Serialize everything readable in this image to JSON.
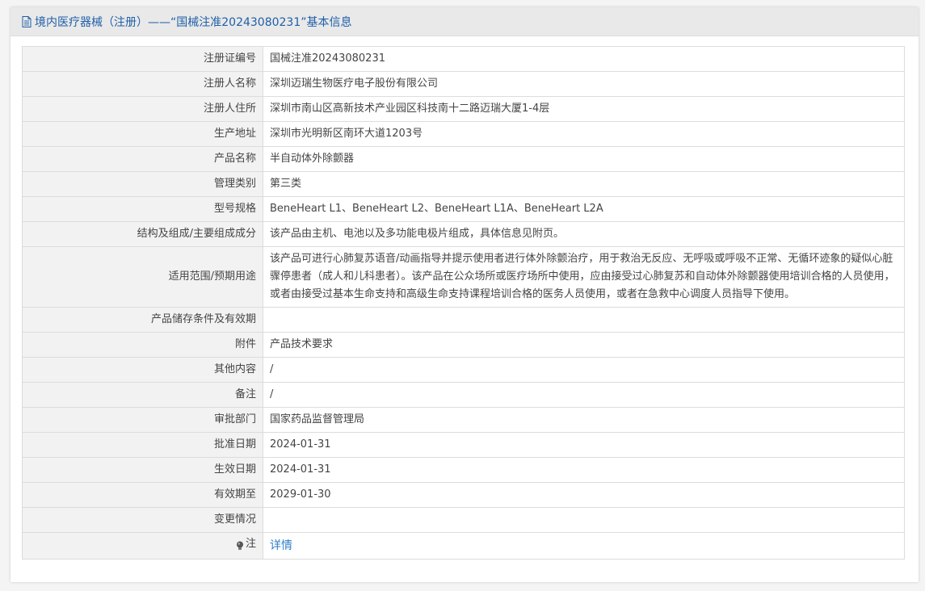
{
  "header": {
    "title": "境内医疗器械（注册）——“国械注准20243080231”基本信息"
  },
  "rows": [
    {
      "label": "注册证编号",
      "value": "国械注准20243080231"
    },
    {
      "label": "注册人名称",
      "value": "深圳迈瑞生物医疗电子股份有限公司"
    },
    {
      "label": "注册人住所",
      "value": "深圳市南山区高新技术产业园区科技南十二路迈瑞大厦1-4层"
    },
    {
      "label": "生产地址",
      "value": "深圳市光明新区南环大道1203号"
    },
    {
      "label": "产品名称",
      "value": "半自动体外除颤器"
    },
    {
      "label": "管理类别",
      "value": "第三类"
    },
    {
      "label": "型号规格",
      "value": "BeneHeart L1、BeneHeart L2、BeneHeart L1A、BeneHeart L2A"
    },
    {
      "label": "结构及组成/主要组成成分",
      "value": "该产品由主机、电池以及多功能电极片组成，具体信息见附页。"
    },
    {
      "label": "适用范围/预期用途",
      "value": "该产品可进行心肺复苏语音/动画指导并提示使用者进行体外除颤治疗，用于救治无反应、无呼吸或呼吸不正常、无循环迹象的疑似心脏骤停患者（成人和儿科患者）。该产品在公众场所或医疗场所中使用，应由接受过心肺复苏和自动体外除颤器使用培训合格的人员使用，或者由接受过基本生命支持和高级生命支持课程培训合格的医务人员使用，或者在急救中心调度人员指导下使用。"
    },
    {
      "label": "产品储存条件及有效期",
      "value": ""
    },
    {
      "label": "附件",
      "value": "产品技术要求"
    },
    {
      "label": "其他内容",
      "value": "/"
    },
    {
      "label": "备注",
      "value": "/"
    },
    {
      "label": "审批部门",
      "value": "国家药品监督管理局"
    },
    {
      "label": "批准日期",
      "value": "2024-01-31"
    },
    {
      "label": "生效日期",
      "value": "2024-01-31"
    },
    {
      "label": "有效期至",
      "value": "2029-01-30"
    },
    {
      "label": "变更情况",
      "value": ""
    }
  ],
  "note": {
    "label": "注",
    "link": "详情"
  }
}
